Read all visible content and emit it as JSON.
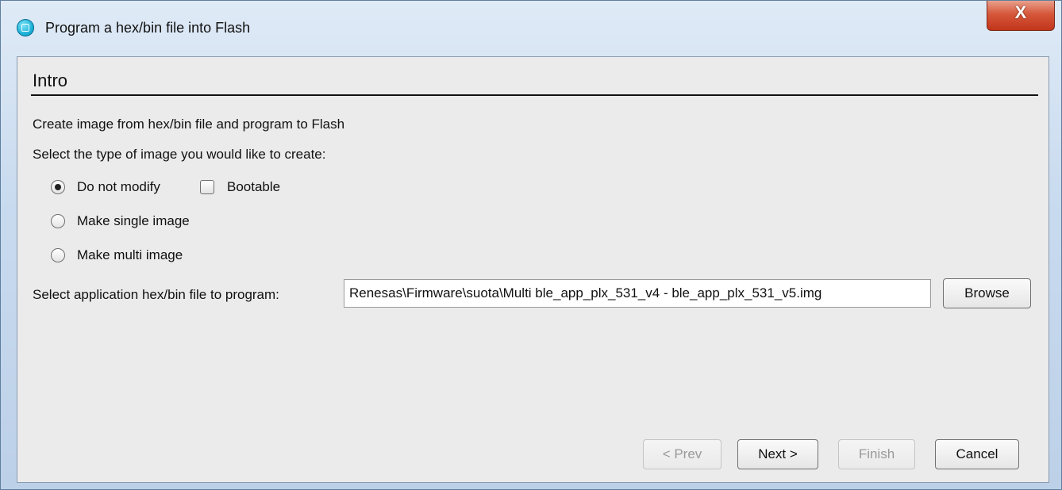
{
  "window": {
    "title": "Program a hex/bin file into Flash",
    "close_label": "X"
  },
  "wizard": {
    "section_title": "Intro",
    "description": "Create image from hex/bin file and program to Flash",
    "type_prompt": "Select the type of image you would like to create:",
    "options": [
      {
        "label": "Do not modify",
        "selected": true
      },
      {
        "label": "Make single image",
        "selected": false
      },
      {
        "label": "Make multi image",
        "selected": false
      }
    ],
    "bootable": {
      "label": "Bootable",
      "checked": false
    },
    "file_label": "Select application hex/bin file to program:",
    "file_value": "Renesas\\Firmware\\suota\\Multi ble_app_plx_531_v4 - ble_app_plx_531_v5.img",
    "browse_label": "Browse"
  },
  "footer": {
    "prev_label": "< Prev",
    "next_label": "Next >",
    "finish_label": "Finish",
    "cancel_label": "Cancel"
  },
  "colors": {
    "title_gradient": "#c9dbef",
    "panel_bg": "#ebebeb",
    "close_red": "#d6573a"
  }
}
